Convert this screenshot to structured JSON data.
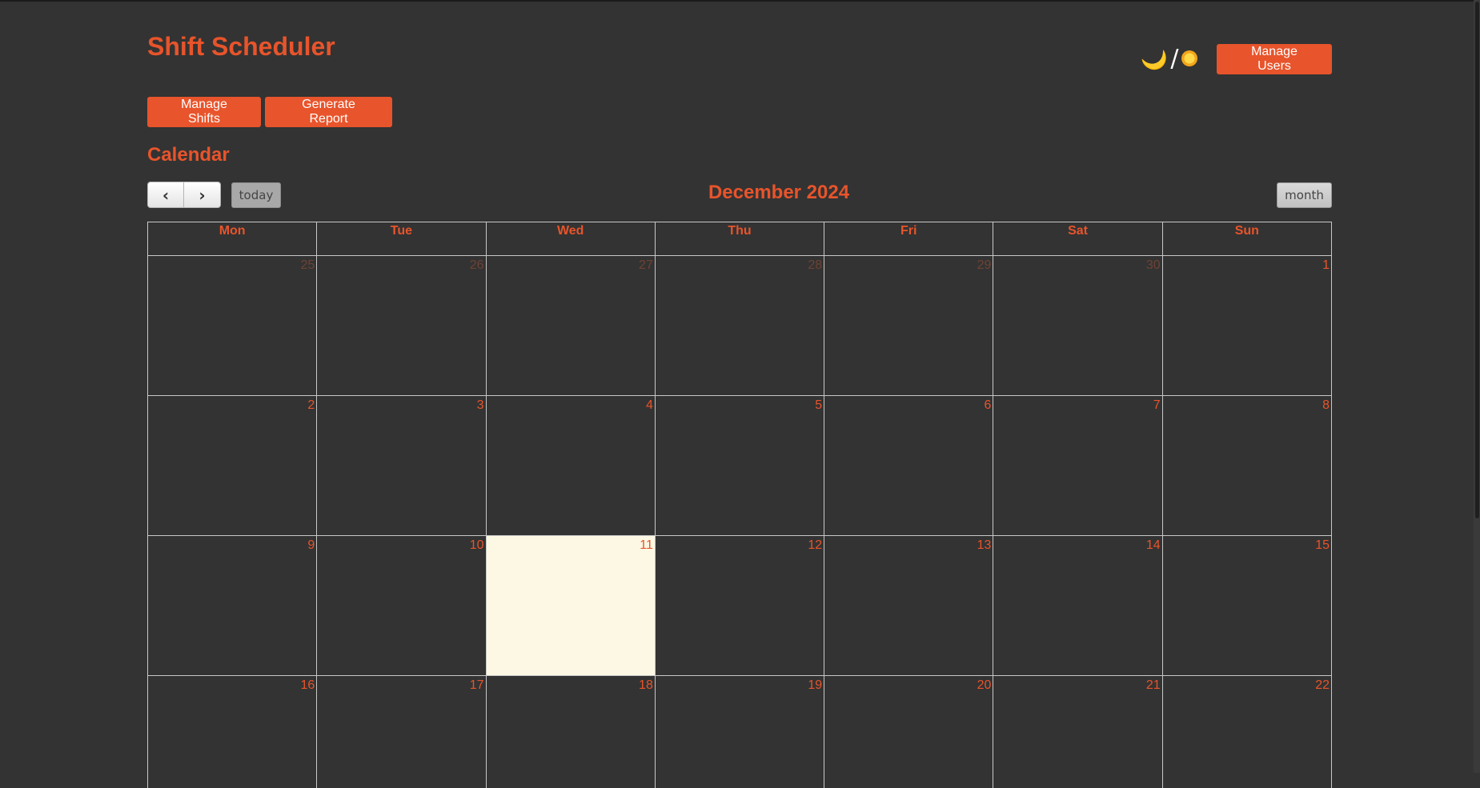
{
  "header": {
    "title": "Shift Scheduler",
    "theme_toggle": {
      "moon_icon": "🌙",
      "separator": "/",
      "sun_icon": "sun"
    },
    "manage_users_label": "Manage Users"
  },
  "toolbar": {
    "manage_shifts_label": "Manage Shifts",
    "generate_report_label": "Generate Report"
  },
  "section": {
    "title": "Calendar"
  },
  "calendar": {
    "prev_label": "‹",
    "next_label": "›",
    "today_label": "today",
    "title": "December 2024",
    "view_label": "month",
    "weekdays": [
      "Mon",
      "Tue",
      "Wed",
      "Thu",
      "Fri",
      "Sat",
      "Sun"
    ],
    "weeks": [
      [
        "25",
        "26",
        "27",
        "28",
        "29",
        "30",
        "1"
      ],
      [
        "2",
        "3",
        "4",
        "5",
        "6",
        "7",
        "8"
      ],
      [
        "9",
        "10",
        "11",
        "12",
        "13",
        "14",
        "15"
      ],
      [
        "16",
        "17",
        "18",
        "19",
        "20",
        "21",
        "22"
      ]
    ],
    "other_month_days": 6,
    "today": "11"
  },
  "colors": {
    "accent": "#e8542b",
    "background": "#333333",
    "today_highlight": "#fdf8e4"
  }
}
